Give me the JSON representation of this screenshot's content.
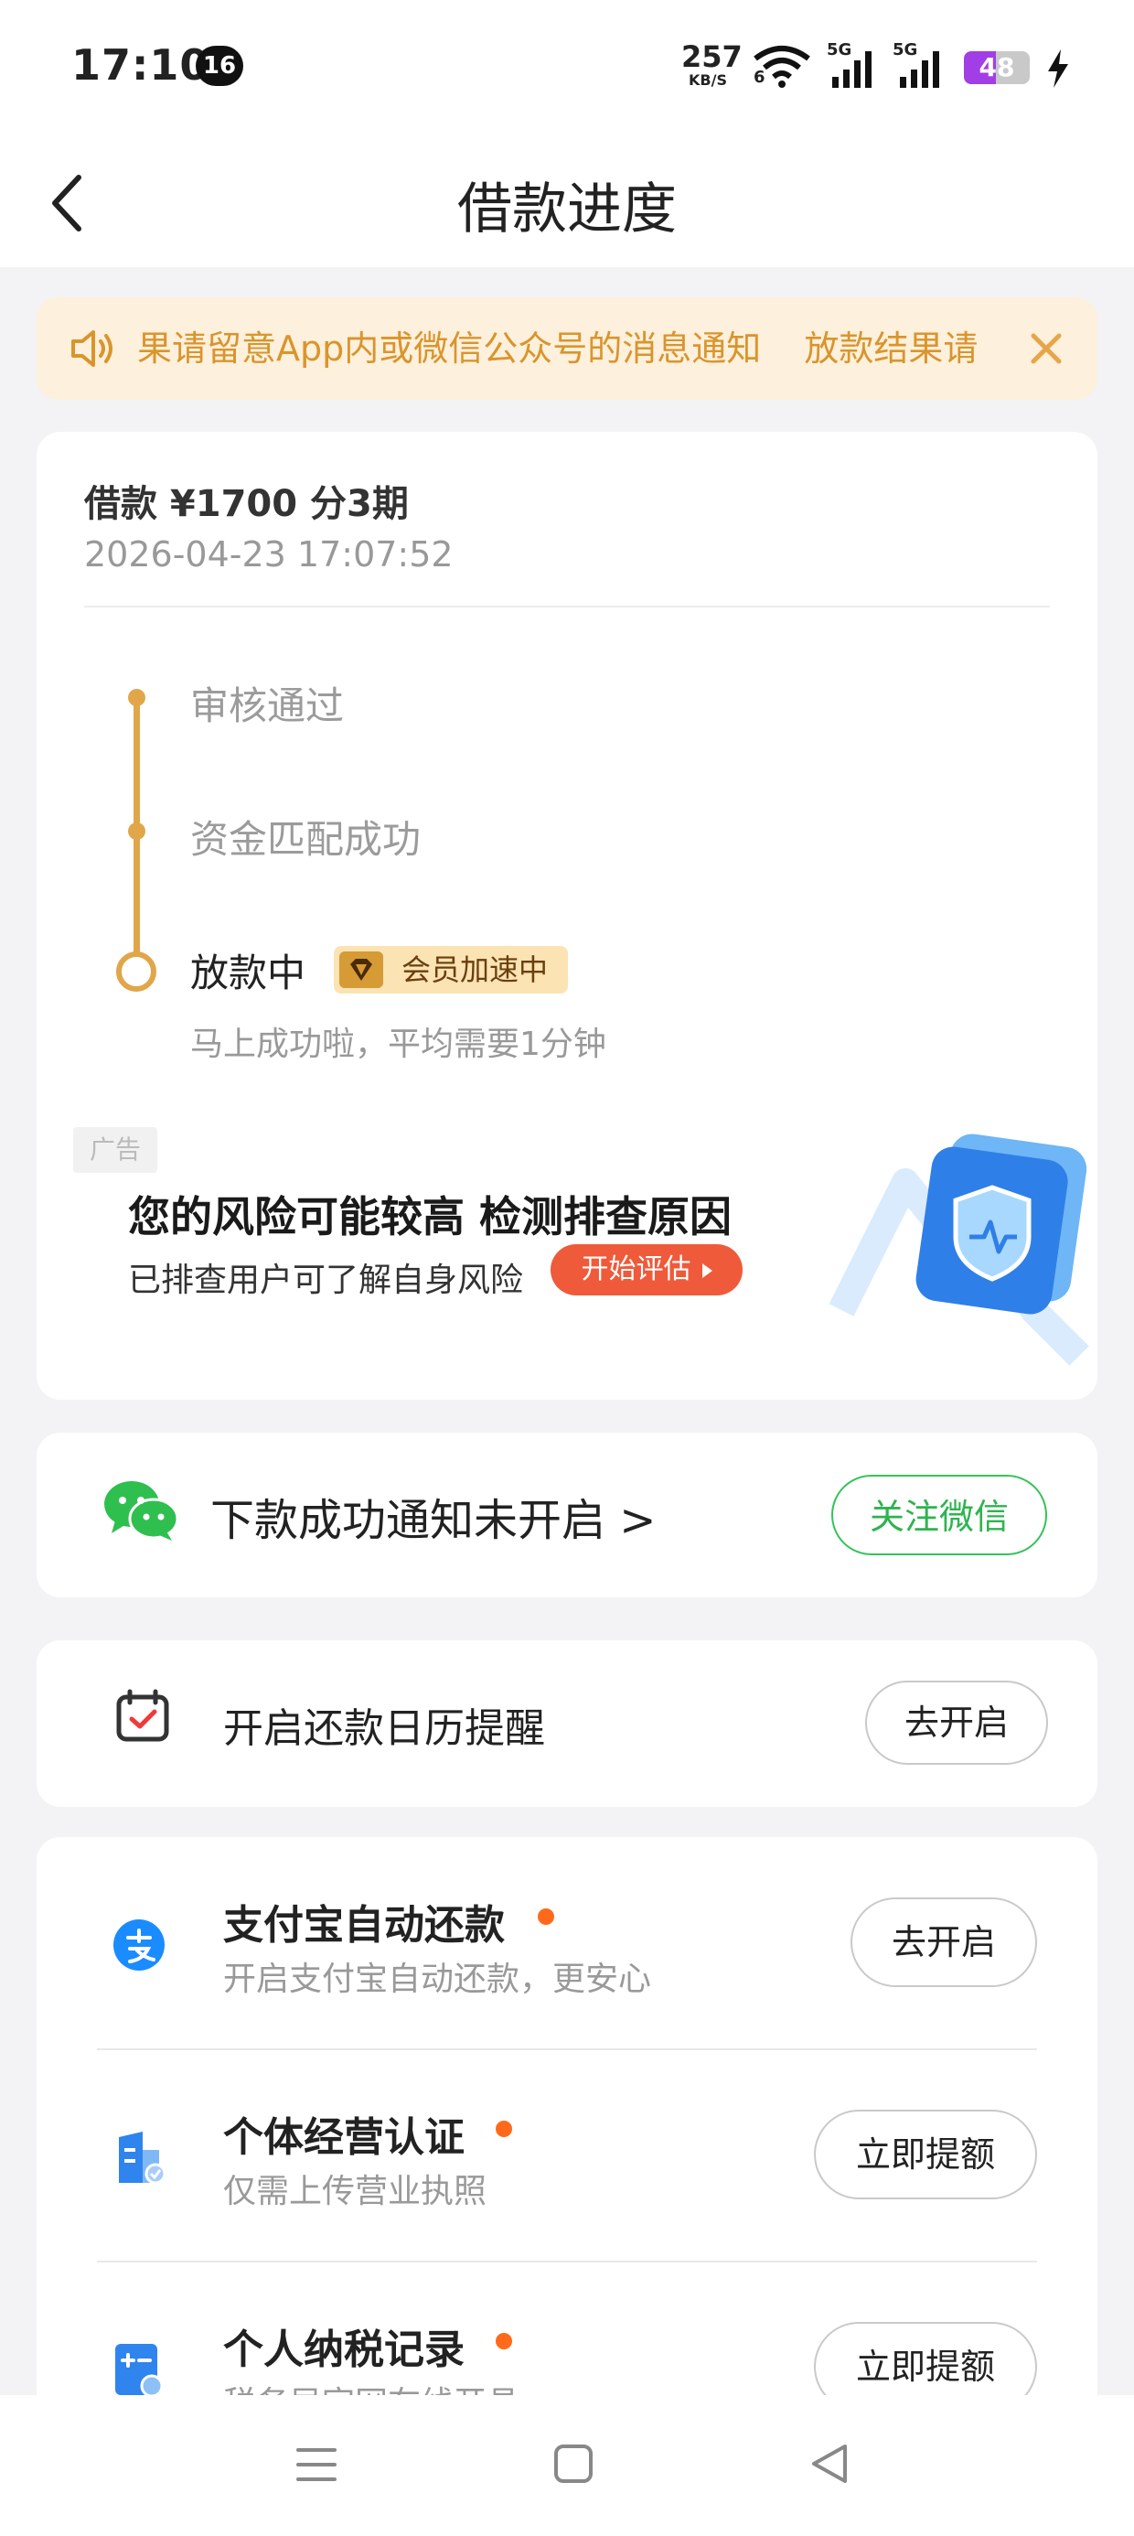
{
  "status_bar": {
    "time": "17:10",
    "notification_count": "16",
    "net_speed": "257",
    "net_speed_unit": "KB/S",
    "wifi_label": "6",
    "signal1_label": "5G",
    "signal2_label": "5G",
    "battery": "48",
    "battery_fraction": 0.48
  },
  "nav": {
    "title": "借款进度"
  },
  "notice": {
    "text_1": "果请留意App内或微信公众号的消息通知",
    "text_2": "放款结果请"
  },
  "loan": {
    "title": "借款 ¥1700  分3期",
    "date": "2026-04-23 17:07:52",
    "steps": [
      {
        "label": "审核通过"
      },
      {
        "label": "资金匹配成功"
      },
      {
        "label": "放款中"
      }
    ],
    "vip_badge": "会员加速中",
    "current_hint": "马上成功啦，平均需要1分钟"
  },
  "ad": {
    "tag": "广告",
    "title": "您的风险可能较高 检测排查原因",
    "subtitle": "已排查用户可了解自身风险",
    "button": "开始评估"
  },
  "wechat": {
    "text": "下款成功通知未开启 >",
    "button": "关注微信"
  },
  "calendar": {
    "text": "开启还款日历提醒",
    "button": "去开启"
  },
  "services": [
    {
      "title": "支付宝自动还款",
      "subtitle": "开启支付宝自动还款，更安心",
      "button": "去开启"
    },
    {
      "title": "个体经营认证",
      "subtitle": "仅需上传营业执照",
      "button": "立即提额"
    },
    {
      "title": "个人纳税记录",
      "subtitle": "税务局官网在线开具",
      "button": "立即提额"
    }
  ],
  "colors": {
    "accent": "#e1a64a",
    "notice_bg": "#fdf0dc",
    "notice_text": "#d9952c",
    "wechat_green": "#2fb34f",
    "dot_orange": "#ff6a1a",
    "ad_button": "#ef5a3a"
  },
  "icons": {
    "back": "chevron-left-icon",
    "notice": "speaker-icon",
    "close": "close-icon",
    "wechat": "wechat-icon",
    "calendar": "calendar-check-icon",
    "alipay": "alipay-icon",
    "business": "building-icon",
    "tax": "calculator-icon",
    "nav_menu": "menu-icon",
    "nav_home": "home-square-icon",
    "nav_back": "back-triangle-icon"
  }
}
